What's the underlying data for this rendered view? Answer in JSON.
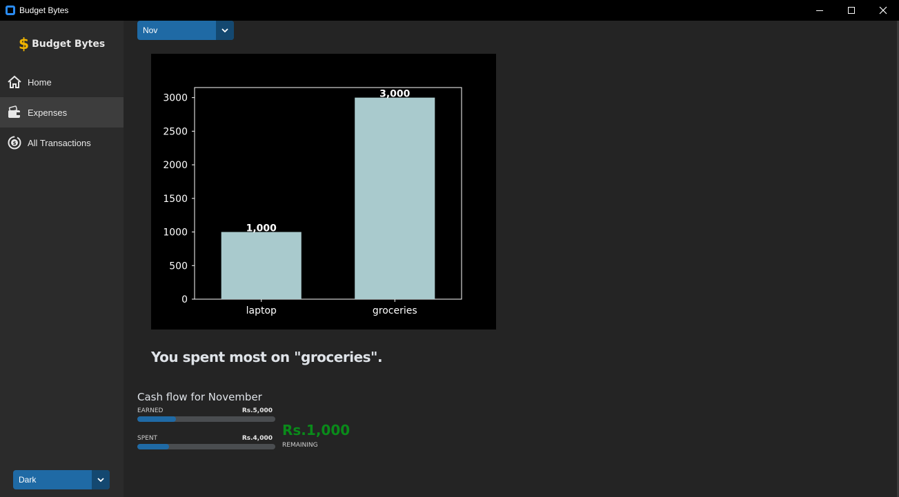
{
  "window": {
    "title": "Budget Bytes",
    "controls": [
      "minimize-icon",
      "maximize-icon",
      "close-icon"
    ]
  },
  "sidebar": {
    "brand": {
      "icon": "dollar-icon",
      "name": "Budget Bytes"
    },
    "items": [
      {
        "label": "Home",
        "icon": "home-icon",
        "active": false
      },
      {
        "label": "Expenses",
        "icon": "wallet-icon",
        "active": true
      },
      {
        "label": "All Transactions",
        "icon": "transactions-icon",
        "active": false
      }
    ],
    "theme_select": {
      "value": "Dark"
    }
  },
  "month_select": {
    "value": "Nov"
  },
  "chart_data": {
    "type": "bar",
    "categories": [
      "laptop",
      "groceries"
    ],
    "values": [
      1000,
      3000
    ],
    "data_labels": [
      "1,000",
      "3,000"
    ],
    "yticks": [
      "0",
      "500",
      "1000",
      "1500",
      "2000",
      "2500",
      "3000"
    ],
    "ylim": [
      0,
      3150
    ],
    "bar_color": "#a9cacd",
    "background": "#000000",
    "title": "",
    "xlabel": "",
    "ylabel": ""
  },
  "summary": {
    "text": "You spent most on \"groceries\"."
  },
  "cash_flow": {
    "title": "Cash flow for November",
    "earned": {
      "label": "EARNED",
      "amount": "Rs.5,000",
      "fill_fraction": 0.28
    },
    "spent": {
      "label": "SPENT",
      "amount": "Rs.4,000",
      "fill_fraction": 0.23
    },
    "remaining": {
      "value": "Rs.1,000",
      "label": "REMAINING",
      "color": "#0a8a1a"
    }
  },
  "colors": {
    "accent": "#1f6aa5",
    "accent_dark": "#144870",
    "brand_icon": "#f0b400"
  }
}
